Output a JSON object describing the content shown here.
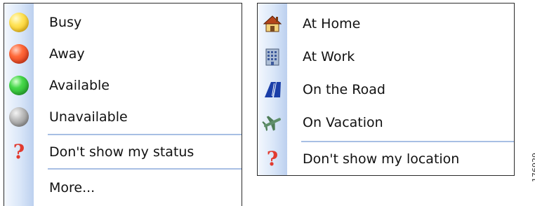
{
  "status_menu": {
    "items": [
      {
        "label": "Busy",
        "icon": "busy-orb-icon",
        "color": "#f7c21a"
      },
      {
        "label": "Away",
        "icon": "away-orb-icon",
        "color": "#ee4a25"
      },
      {
        "label": "Available",
        "icon": "available-orb-icon",
        "color": "#35c43a"
      },
      {
        "label": "Unavailable",
        "icon": "unavailable-orb-icon",
        "color": "#a5a5a5"
      }
    ],
    "hide_label": "Don't show my status",
    "more_label": "More..."
  },
  "location_menu": {
    "items": [
      {
        "label": "At Home",
        "icon": "house-icon"
      },
      {
        "label": "At Work",
        "icon": "office-building-icon"
      },
      {
        "label": "On the Road",
        "icon": "road-icon"
      },
      {
        "label": "On Vacation",
        "icon": "airplane-icon"
      }
    ],
    "hide_label": "Don't show my location"
  },
  "figure_code": "176929",
  "colors": {
    "gutter": "#c6d8f3",
    "separator": "#a8bfe4",
    "question_mark": "#e23a2f"
  }
}
